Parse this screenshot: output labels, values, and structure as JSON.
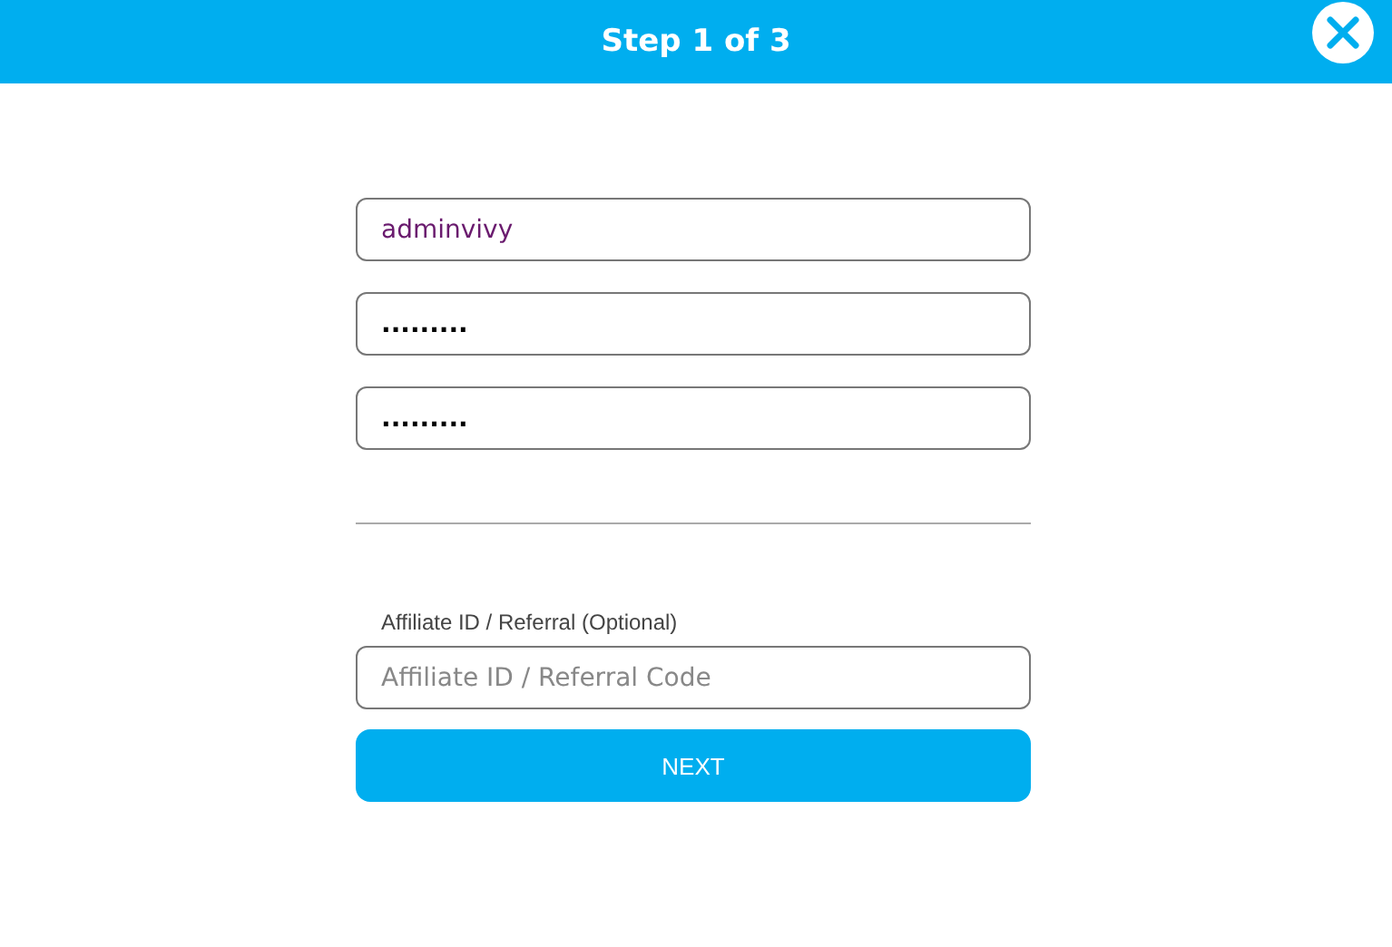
{
  "header": {
    "title": "Step 1 of 3"
  },
  "fields": [
    {
      "kind": "text",
      "value": "adminvivy"
    },
    {
      "kind": "password",
      "value": "........."
    },
    {
      "kind": "password",
      "value": "........."
    }
  ],
  "referral": {
    "label": "Affiliate ID / Referral (Optional)",
    "placeholder": "Affiliate ID / Referral Code"
  },
  "button": "NEXT"
}
